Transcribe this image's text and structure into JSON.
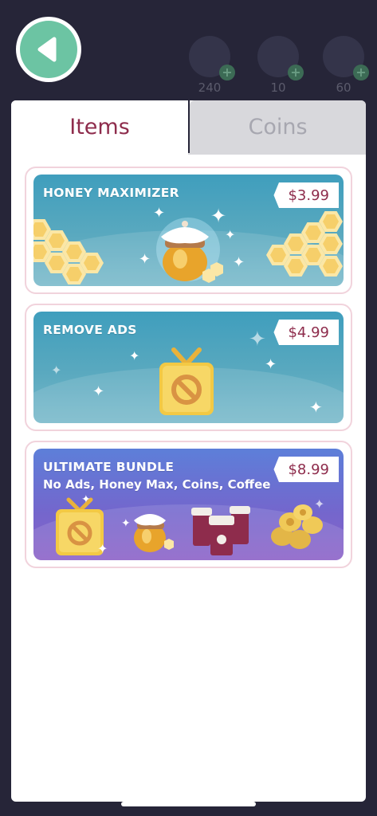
{
  "header": {
    "back_icon": "back-arrow-icon",
    "resources": [
      {
        "name": "pancake",
        "count": "240"
      },
      {
        "name": "blueberry",
        "count": "10"
      },
      {
        "name": "character",
        "count": "60"
      }
    ]
  },
  "tabs": [
    {
      "label": "Items",
      "active": true
    },
    {
      "label": "Coins",
      "active": false
    }
  ],
  "products": [
    {
      "title": "HONEY MAXIMIZER",
      "subtitle": "",
      "price": "$3.99",
      "icon": "honey-jar-icon"
    },
    {
      "title": "REMOVE ADS",
      "subtitle": "",
      "price": "$4.99",
      "icon": "no-ads-tv-icon"
    },
    {
      "title": "ULTIMATE BUNDLE",
      "subtitle": "No Ads, Honey Max, Coins, Coffee",
      "price": "$8.99",
      "icon": "bundle-icon"
    }
  ],
  "colors": {
    "background": "#262538",
    "accent": "#8e2c4c",
    "back_button": "#6cc4a3",
    "card_border": "#f1d3dc"
  }
}
